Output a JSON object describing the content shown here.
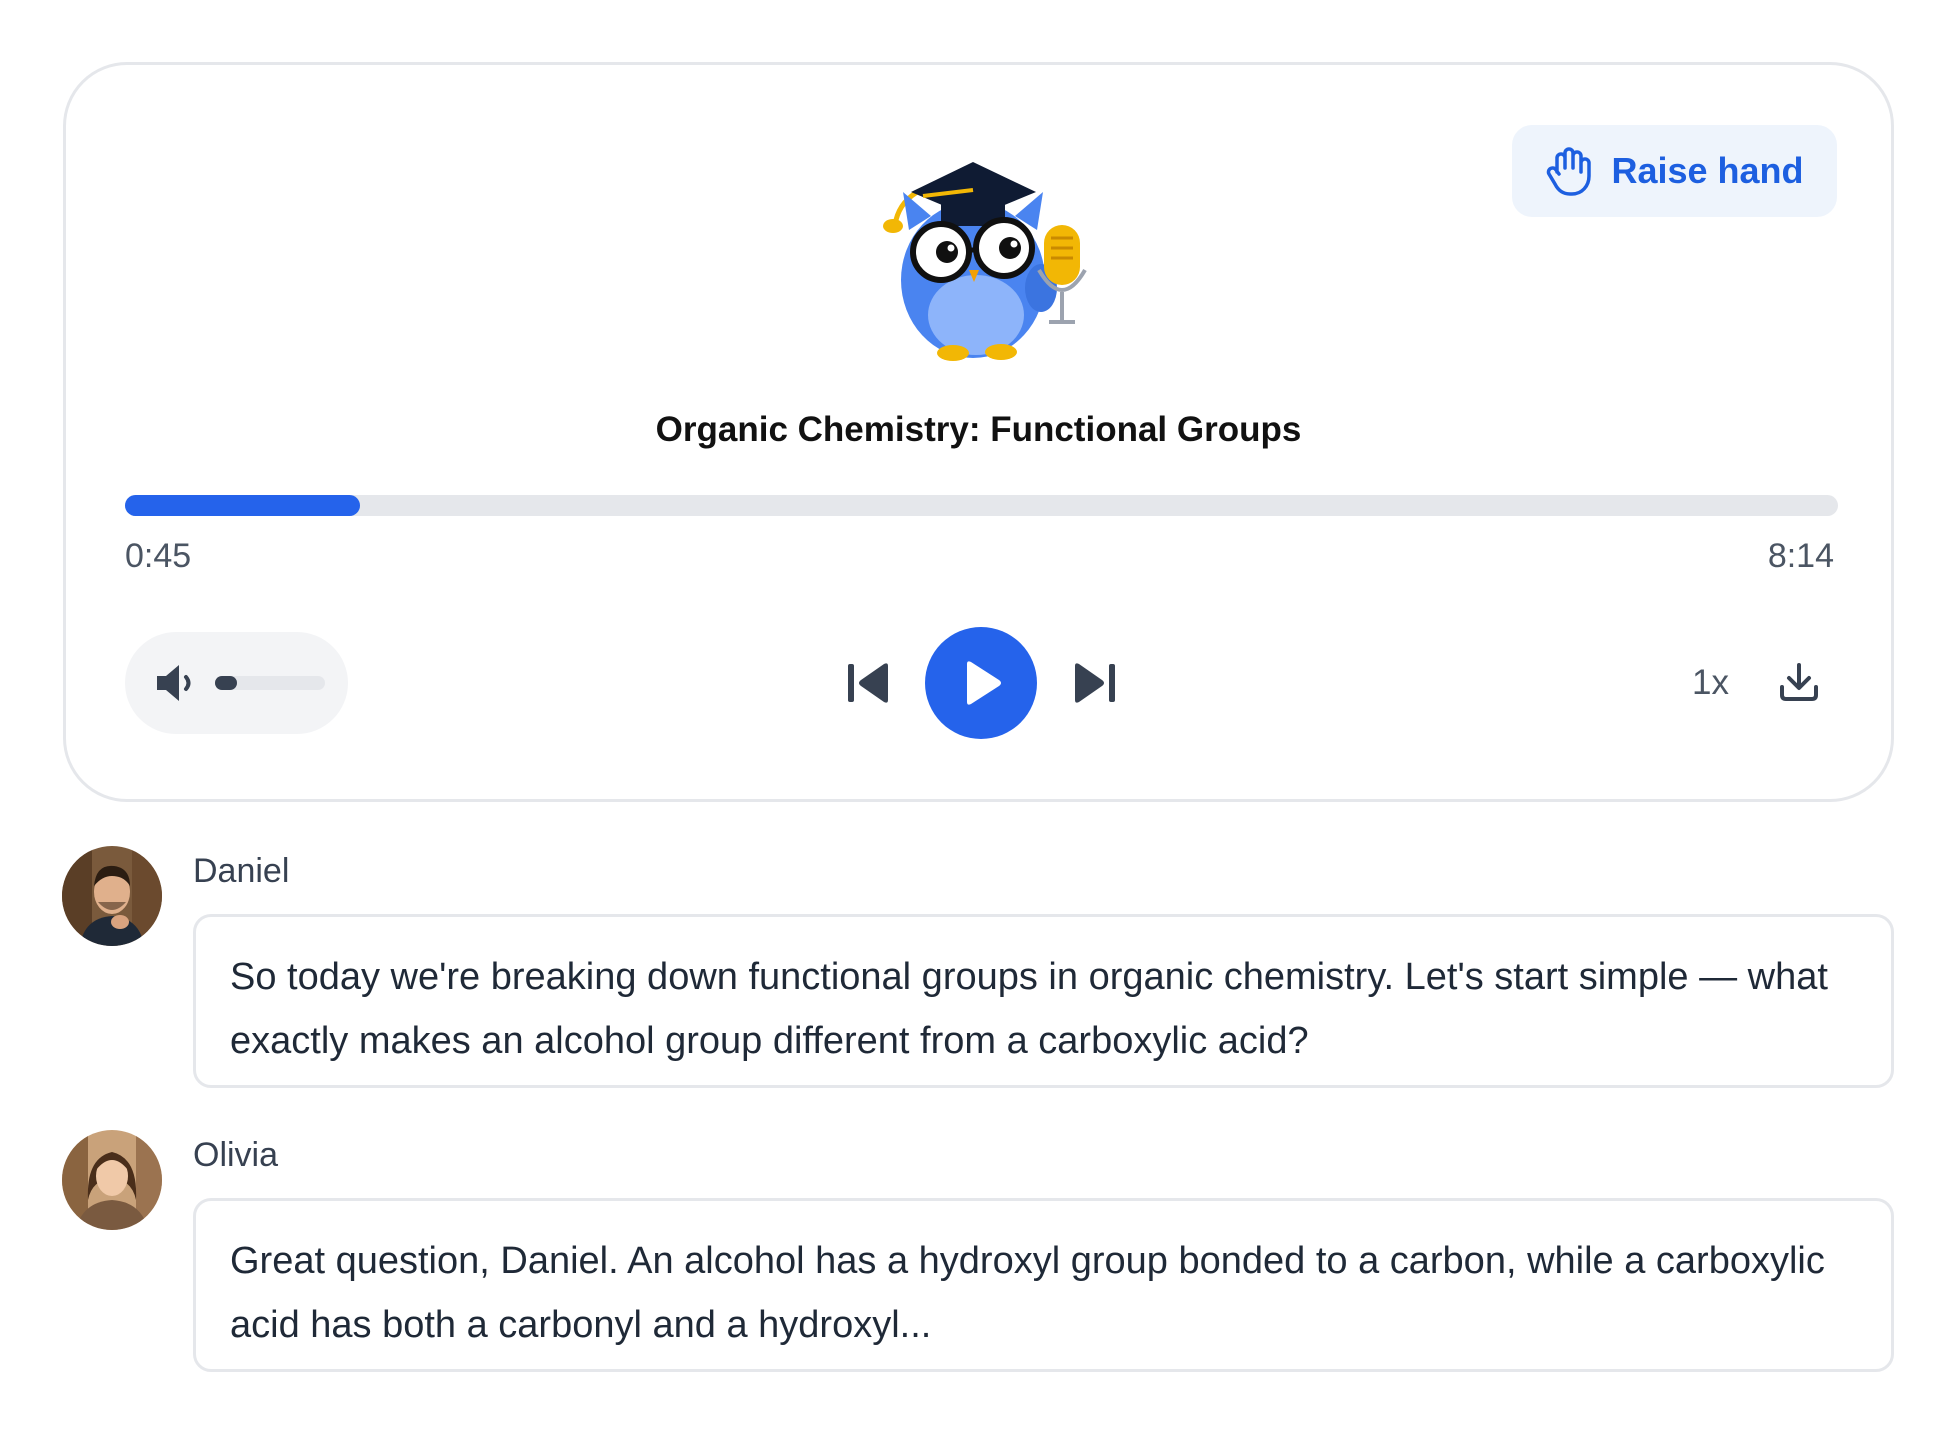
{
  "player": {
    "title": "Organic Chemistry: Functional Groups",
    "raise_hand_label": "Raise hand",
    "current_time": "0:45",
    "total_time": "8:14",
    "progress_fraction": 0.137,
    "volume_fraction": 0.2,
    "speed_label": "1x",
    "accent_color": "#2563eb"
  },
  "transcript": [
    {
      "speaker": "Daniel",
      "text": "So today we're breaking down functional groups in organic chemistry. Let's start simple — what exactly makes an alcohol group different from a carboxylic acid?"
    },
    {
      "speaker": "Olivia",
      "text": "Great question, Daniel. An alcohol has a hydroxyl group bonded to a carbon, while a carboxylic acid has both a carbonyl and a hydroxyl..."
    }
  ]
}
